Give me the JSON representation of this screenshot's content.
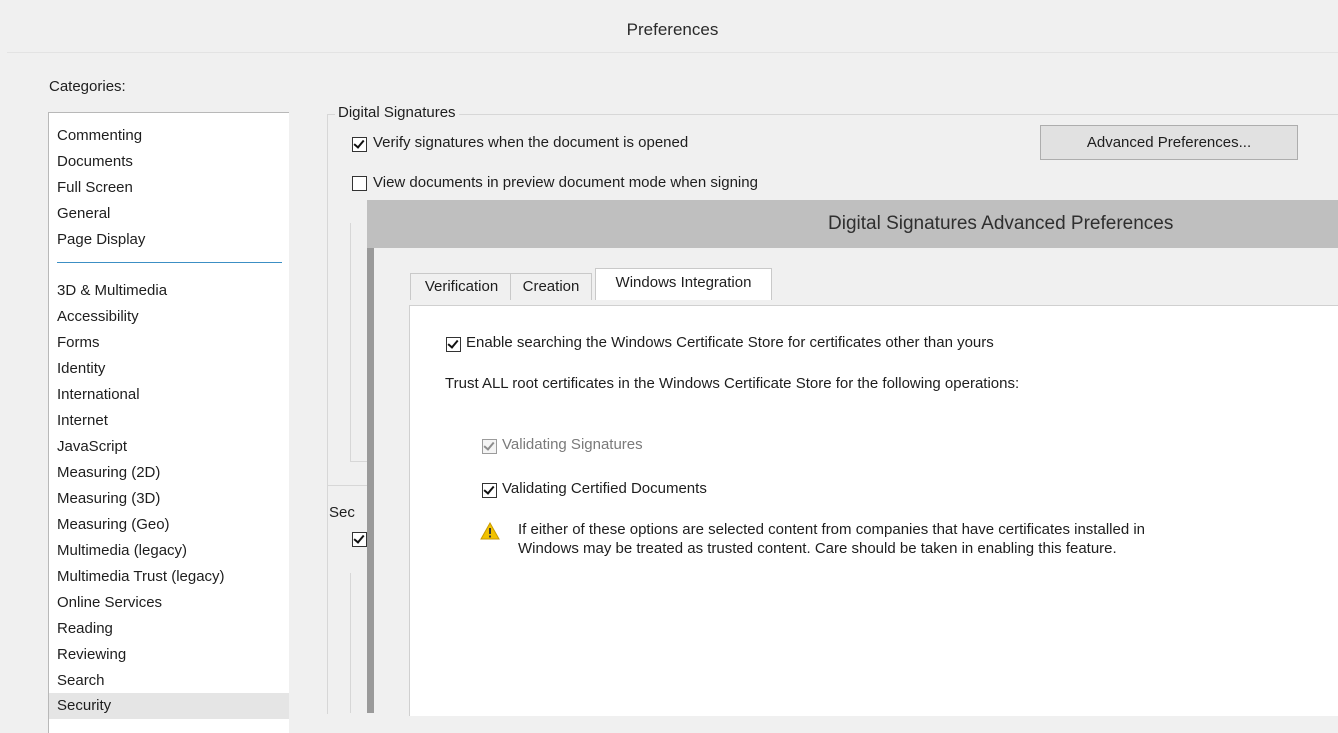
{
  "window": {
    "title": "Preferences"
  },
  "categories": {
    "label": "Categories:",
    "items_top": [
      "Commenting",
      "Documents",
      "Full Screen",
      "General",
      "Page Display"
    ],
    "items_bottom": [
      "3D & Multimedia",
      "Accessibility",
      "Forms",
      "Identity",
      "International",
      "Internet",
      "JavaScript",
      "Measuring (2D)",
      "Measuring (3D)",
      "Measuring (Geo)",
      "Multimedia (legacy)",
      "Multimedia Trust (legacy)",
      "Online Services",
      "Reading",
      "Reviewing",
      "Search",
      "Security"
    ],
    "selected": "Security"
  },
  "digital_signatures": {
    "group_label": "Digital Signatures",
    "verify_on_open": {
      "label": "Verify signatures when the document is opened",
      "checked": true
    },
    "preview_mode": {
      "label": "View documents in preview document mode when signing",
      "checked": false
    },
    "advanced_button": "Advanced Preferences..."
  },
  "security_group": {
    "label_fragment": "Sec"
  },
  "advanced_dialog": {
    "title": "Digital Signatures Advanced Preferences",
    "tabs": [
      "Verification",
      "Creation",
      "Windows Integration"
    ],
    "active_tab": "Windows Integration",
    "enable_search": {
      "label": "Enable searching the Windows Certificate Store for certificates other than yours",
      "checked": true
    },
    "trust_text": "Trust ALL root certificates in the Windows Certificate Store for the following operations:",
    "validating_signatures": {
      "label": "Validating Signatures",
      "checked": true,
      "disabled": true
    },
    "validating_certified": {
      "label": "Validating Certified Documents",
      "checked": true
    },
    "warning_icon": "warning-triangle-icon",
    "warning_text": "If either of these options are selected content from companies that have certificates installed in Windows may be treated as trusted content. Care should be taken in enabling this feature."
  },
  "colors": {
    "accent_divider": "#3c8fc4",
    "warning_yellow": "#f2c200"
  }
}
